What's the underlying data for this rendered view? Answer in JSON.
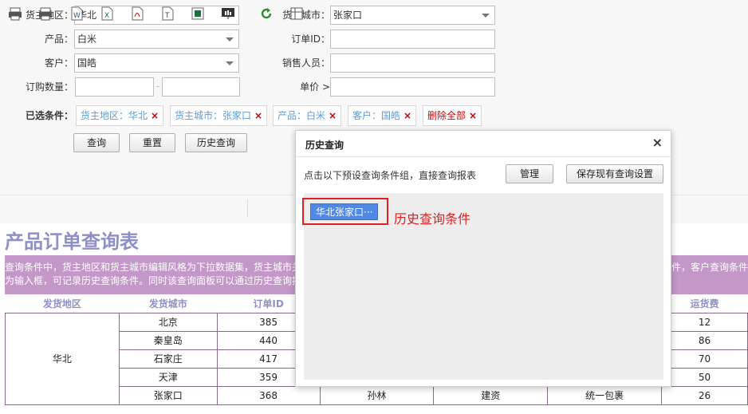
{
  "filters": {
    "shipper_region": {
      "label": "货主地区：",
      "value": "华北"
    },
    "shipper_city": {
      "label": "货主城市：",
      "value": "张家口"
    },
    "product": {
      "label": "产品：",
      "value": "白米"
    },
    "order_id": {
      "label": "订单ID：",
      "value": ""
    },
    "customer": {
      "label": "客户：",
      "value": "国皓"
    },
    "salesperson": {
      "label": "销售人员：",
      "value": ""
    },
    "quantity": {
      "label": "订购数量：",
      "from": "",
      "to": "",
      "separator": "-"
    },
    "unit_price": {
      "label": "单价 >",
      "value": ""
    }
  },
  "selected": {
    "label": "已选条件：",
    "chips": [
      "货主地区：华北",
      "货主城市：张家口",
      "产品：白米",
      "客户：国皓"
    ],
    "clear_all": "删除全部",
    "remove_glyph": "×"
  },
  "actions": {
    "query": "查询",
    "reset": "重置",
    "history": "历史查询"
  },
  "toolbar": {
    "icons": [
      "print-preview-icon",
      "print-icon",
      "export-word-icon",
      "export-excel-icon",
      "export-pdf-icon",
      "export-text-icon",
      "export-image-icon",
      "presentation-icon",
      "refresh-icon",
      "layout-icon"
    ]
  },
  "report": {
    "title": "产品订单查询表",
    "description_lines": [
      "查询条件中，货主地区和货主城市编辑风格为下拉数据集，货主城市关",
      "为输入框，可记录历史查询条件。同时该查询面板可以通过历史查询按"
    ],
    "description_right": "条件，客户查询条件",
    "columns": [
      "发货地区",
      "发货城市",
      "订单ID",
      "",
      "",
      "",
      "运货费"
    ],
    "region": "华北",
    "rows": [
      {
        "city": "北京",
        "order_id": "385",
        "c4": "",
        "c5": "",
        "c6": "",
        "freight": "12"
      },
      {
        "city": "秦皇岛",
        "order_id": "440",
        "c4": "",
        "c5": "",
        "c6": "",
        "freight": "86"
      },
      {
        "city": "石家庄",
        "order_id": "417",
        "c4": "",
        "c5": "",
        "c6": "",
        "freight": "70"
      },
      {
        "city": "天津",
        "order_id": "359",
        "c4": "",
        "c5": "",
        "c6": "",
        "freight": "50"
      },
      {
        "city": "张家口",
        "order_id": "368",
        "c4": "孙林",
        "c5": "建资",
        "c6": "统一包裹",
        "freight": "26"
      }
    ]
  },
  "dialog": {
    "title": "历史查询",
    "close": "×",
    "hint": "点击以下预设查询条件组，直接查询报表",
    "manage": "管理",
    "save": "保存现有查询设置",
    "preset": "华北张家口···"
  },
  "annotation": {
    "text": "历史查询条件",
    "color": "#e02020"
  },
  "colors": {
    "title": "#8e8fc6",
    "desc_bg": "#c397c8",
    "preset_bg": "#5187e5",
    "chip_text": "#5b9bd5"
  }
}
